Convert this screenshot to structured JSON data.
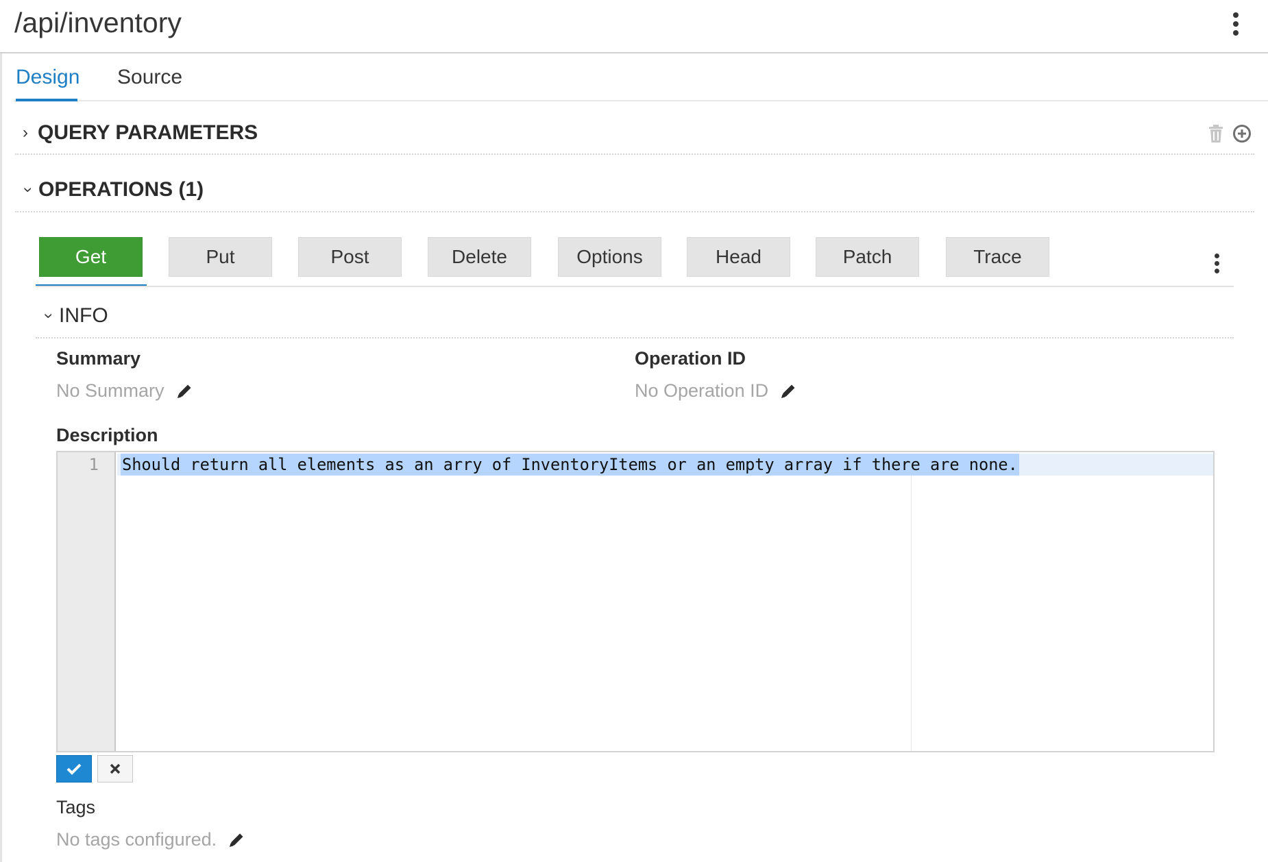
{
  "header": {
    "title": "/api/inventory"
  },
  "tabs": [
    {
      "label": "Design",
      "active": true
    },
    {
      "label": "Source",
      "active": false
    }
  ],
  "sections": {
    "query_parameters": {
      "title": "QUERY PARAMETERS",
      "expanded": false
    },
    "operations": {
      "title": "OPERATIONS (1)",
      "expanded": true
    }
  },
  "methods": [
    "Get",
    "Put",
    "Post",
    "Delete",
    "Options",
    "Head",
    "Patch",
    "Trace"
  ],
  "active_method": "Get",
  "info": {
    "title": "INFO",
    "summary_label": "Summary",
    "summary_value": "No Summary",
    "operation_id_label": "Operation ID",
    "operation_id_value": "No Operation ID",
    "description_label": "Description",
    "description_line_number": "1",
    "description_text": "Should return all elements as an arry of InventoryItems or an empty array if there are none.",
    "tags_label": "Tags",
    "tags_value": "No tags configured."
  },
  "icons": {
    "header_menu": "kebab-icon",
    "delete": "trash-icon",
    "add": "plus-circle-icon",
    "edit": "pencil-icon",
    "confirm": "check-icon",
    "cancel": "times-icon"
  },
  "colors": {
    "accent": "#1f7fc4",
    "active_method": "#3f9c35",
    "confirm_button": "#1f88d3",
    "selection": "#b5d5ff"
  }
}
